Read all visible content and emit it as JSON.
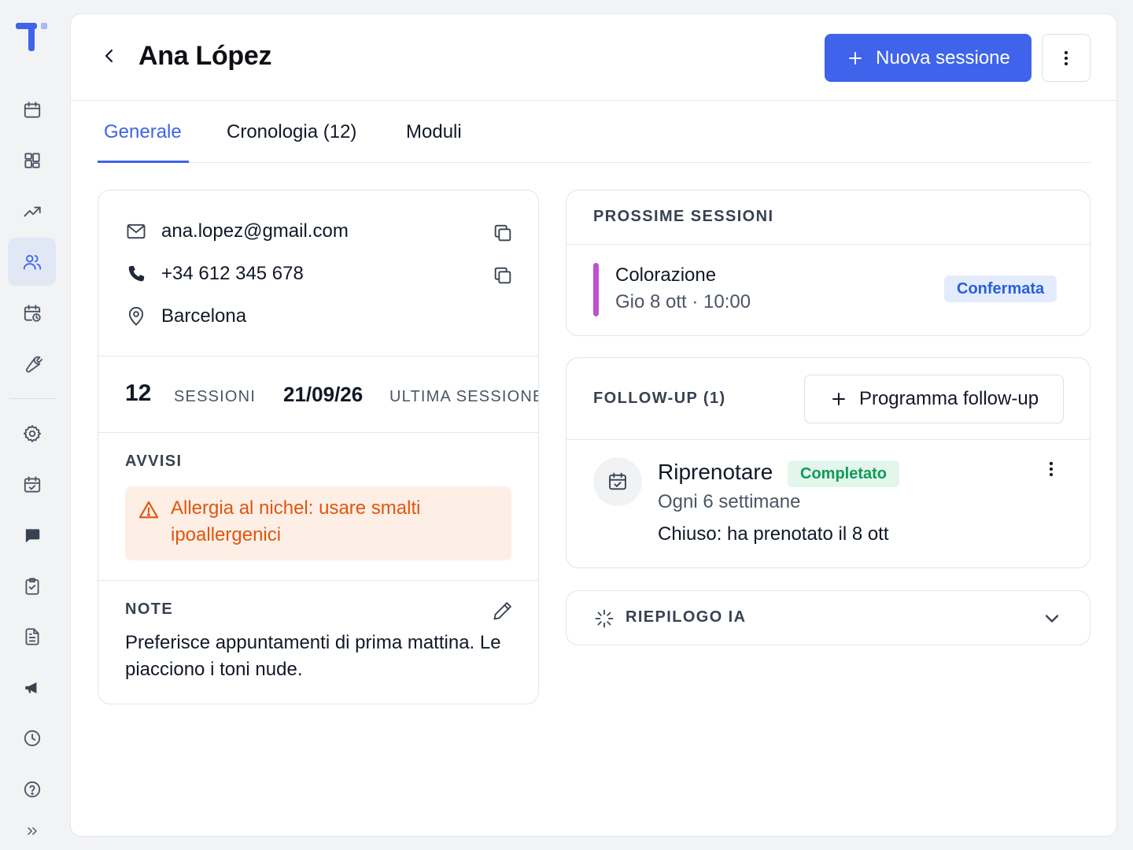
{
  "colors": {
    "accent": "#3F63EA",
    "alert_text": "#E0560C",
    "alert_bg": "#FDEEE6",
    "session_bar": "#C14FD0",
    "badge_blue": "#2A5FD8",
    "badge_green": "#119A58"
  },
  "sidebar": {
    "items": [
      {
        "icon": "calendar-icon"
      },
      {
        "icon": "dashboard-icon"
      },
      {
        "icon": "trending-up-icon"
      },
      {
        "icon": "users-icon",
        "active": true
      },
      {
        "icon": "calendar-clock-icon"
      },
      {
        "icon": "wrench-icon"
      },
      {
        "icon": "gear-icon"
      },
      {
        "icon": "calendar-check-icon"
      },
      {
        "icon": "chat-icon"
      },
      {
        "icon": "clipboard-check-icon"
      },
      {
        "icon": "document-icon"
      },
      {
        "icon": "megaphone-icon"
      },
      {
        "icon": "clock-icon"
      },
      {
        "icon": "help-icon"
      },
      {
        "icon": "expand-icon"
      }
    ]
  },
  "header": {
    "title": "Ana López",
    "primary_button": "Nuova sessione"
  },
  "tabs": [
    {
      "label": "Generale",
      "active": true
    },
    {
      "label": "Cronologia (12)"
    },
    {
      "label": "Moduli"
    }
  ],
  "contact": {
    "email": "ana.lopez@gmail.com",
    "phone": "+34 612 345 678",
    "city": "Barcelona"
  },
  "stats": {
    "sessions_count": "12",
    "sessions_label": "SESSIONI",
    "last_date": "21/09/26",
    "last_label": "ULTIMA SESSIONE"
  },
  "alerts": {
    "label": "AVVISI",
    "items": [
      "Allergia al nichel: usare smalti ipoallergenici"
    ]
  },
  "notes": {
    "label": "NOTE",
    "text": "Preferisce appuntamenti di prima mattina. Le piacciono i toni nude."
  },
  "upcoming": {
    "label": "PROSSIME SESSIONI",
    "items": [
      {
        "title": "Colorazione",
        "when": "Gio 8 ott · 10:00",
        "status": "Confermata"
      }
    ]
  },
  "followup": {
    "label": "FOLLOW-UP (1)",
    "add_button": "Programma follow-up",
    "items": [
      {
        "title": "Riprenotare",
        "status": "Completato",
        "frequency": "Ogni 6 settimane",
        "closed": "Chiuso: ha prenotato il 8 ott"
      }
    ]
  },
  "ai_summary": {
    "label": "RIEPILOGO IA"
  }
}
